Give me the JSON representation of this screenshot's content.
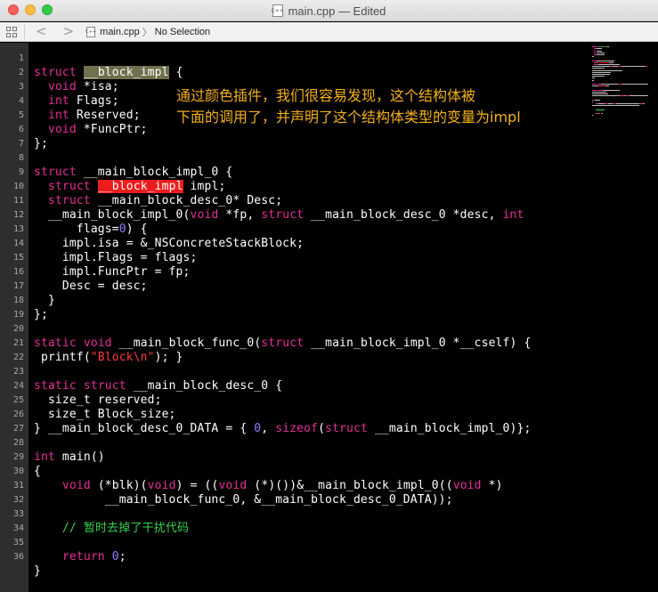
{
  "window": {
    "title": "main.cpp — Edited",
    "doc_icon_text": "C++"
  },
  "jumpbar": {
    "back_glyph": "<",
    "forward_glyph": ">",
    "file_icon_text": "C++",
    "file": "main.cpp",
    "separator": "〉",
    "selection": "No Selection"
  },
  "colors": {
    "keyword": "#e52e97",
    "number": "#8d80f5",
    "string": "#ff3b3b",
    "comment": "#36d34f",
    "annotation": "#f3b01c",
    "highlight_gray": "#70704f",
    "highlight_red": "#ee1d1d"
  },
  "gutter": [
    "1",
    "2",
    "3",
    "4",
    "5",
    "6",
    "7",
    "8",
    "9",
    "10",
    "11",
    "12",
    "13",
    "14",
    "15",
    "16",
    "17",
    "18",
    "19",
    "20",
    "21",
    "22",
    "23",
    "24",
    "25",
    "26",
    "27",
    "28",
    "29",
    "30",
    "31",
    "32",
    "33",
    "34",
    "35",
    "36"
  ],
  "annotation": {
    "line1": "通过颜色插件，我们很容易发现，这个结构体被",
    "line2": "下面的调用了，并声明了这个结构体类型的变量为impl"
  },
  "code": [
    [],
    [
      {
        "t": "struct",
        "c": "kw"
      },
      {
        "t": " "
      },
      {
        "t": "__block_impl",
        "c": "hl-gray"
      },
      {
        "t": " {"
      }
    ],
    [
      {
        "t": "  "
      },
      {
        "t": "void",
        "c": "kw"
      },
      {
        "t": " *isa;"
      }
    ],
    [
      {
        "t": "  "
      },
      {
        "t": "int",
        "c": "kw"
      },
      {
        "t": " Flags;"
      }
    ],
    [
      {
        "t": "  "
      },
      {
        "t": "int",
        "c": "kw"
      },
      {
        "t": " Reserved;"
      }
    ],
    [
      {
        "t": "  "
      },
      {
        "t": "void",
        "c": "kw"
      },
      {
        "t": " *FuncPtr;"
      }
    ],
    [
      {
        "t": "};"
      }
    ],
    [],
    [
      {
        "t": "struct",
        "c": "kw"
      },
      {
        "t": " __main_block_impl_0 {"
      }
    ],
    [
      {
        "t": "  "
      },
      {
        "t": "struct",
        "c": "kw"
      },
      {
        "t": " "
      },
      {
        "t": "__block_impl",
        "c": "hl-red"
      },
      {
        "t": " impl;"
      }
    ],
    [
      {
        "t": "  "
      },
      {
        "t": "struct",
        "c": "kw"
      },
      {
        "t": " __main_block_desc_0* Desc;"
      }
    ],
    [
      {
        "t": "  __main_block_impl_0("
      },
      {
        "t": "void",
        "c": "kw"
      },
      {
        "t": " *fp, "
      },
      {
        "t": "struct",
        "c": "kw"
      },
      {
        "t": " __main_block_desc_0 *desc, "
      },
      {
        "t": "int",
        "c": "kw"
      }
    ],
    [
      {
        "t": "      flags="
      },
      {
        "t": "0",
        "c": "num"
      },
      {
        "t": ") {"
      }
    ],
    [
      {
        "t": "    impl.isa = &_NSConcreteStackBlock;"
      }
    ],
    [
      {
        "t": "    impl.Flags = flags;"
      }
    ],
    [
      {
        "t": "    impl.FuncPtr = fp;"
      }
    ],
    [
      {
        "t": "    Desc = desc;"
      }
    ],
    [
      {
        "t": "  }"
      }
    ],
    [
      {
        "t": "};"
      }
    ],
    [],
    [
      {
        "t": "static",
        "c": "kw"
      },
      {
        "t": " "
      },
      {
        "t": "void",
        "c": "kw"
      },
      {
        "t": " __main_block_func_0("
      },
      {
        "t": "struct",
        "c": "kw"
      },
      {
        "t": " __main_block_impl_0 *__cself) {"
      }
    ],
    [
      {
        "t": " printf("
      },
      {
        "t": "\"Block\\n\"",
        "c": "str"
      },
      {
        "t": "); }"
      }
    ],
    [],
    [
      {
        "t": "static",
        "c": "kw"
      },
      {
        "t": " "
      },
      {
        "t": "struct",
        "c": "kw"
      },
      {
        "t": " __main_block_desc_0 {"
      }
    ],
    [
      {
        "t": "  size_t reserved;"
      }
    ],
    [
      {
        "t": "  size_t Block_size;"
      }
    ],
    [
      {
        "t": "} __main_block_desc_0_DATA = { "
      },
      {
        "t": "0",
        "c": "num"
      },
      {
        "t": ", "
      },
      {
        "t": "sizeof",
        "c": "kw"
      },
      {
        "t": "("
      },
      {
        "t": "struct",
        "c": "kw"
      },
      {
        "t": " __main_block_impl_0)};"
      }
    ],
    [],
    [
      {
        "t": "int",
        "c": "kw"
      },
      {
        "t": " main()"
      }
    ],
    [
      {
        "t": "{"
      }
    ],
    [
      {
        "t": "    "
      },
      {
        "t": "void",
        "c": "kw"
      },
      {
        "t": " (*blk)("
      },
      {
        "t": "void",
        "c": "kw"
      },
      {
        "t": ") = (("
      },
      {
        "t": "void",
        "c": "kw"
      },
      {
        "t": " (*)())&__main_block_impl_0(("
      },
      {
        "t": "void",
        "c": "kw"
      },
      {
        "t": " *)"
      }
    ],
    [
      {
        "t": "          __main_block_func_0, &__main_block_desc_0_DATA));"
      }
    ],
    [],
    [
      {
        "t": "    "
      },
      {
        "t": "// 暂时去掉了干扰代码",
        "c": "cm"
      }
    ],
    [],
    [
      {
        "t": "    "
      },
      {
        "t": "return",
        "c": "kw"
      },
      {
        "t": " "
      },
      {
        "t": "0",
        "c": "num"
      },
      {
        "t": ";"
      }
    ],
    [
      {
        "t": "}"
      }
    ]
  ]
}
